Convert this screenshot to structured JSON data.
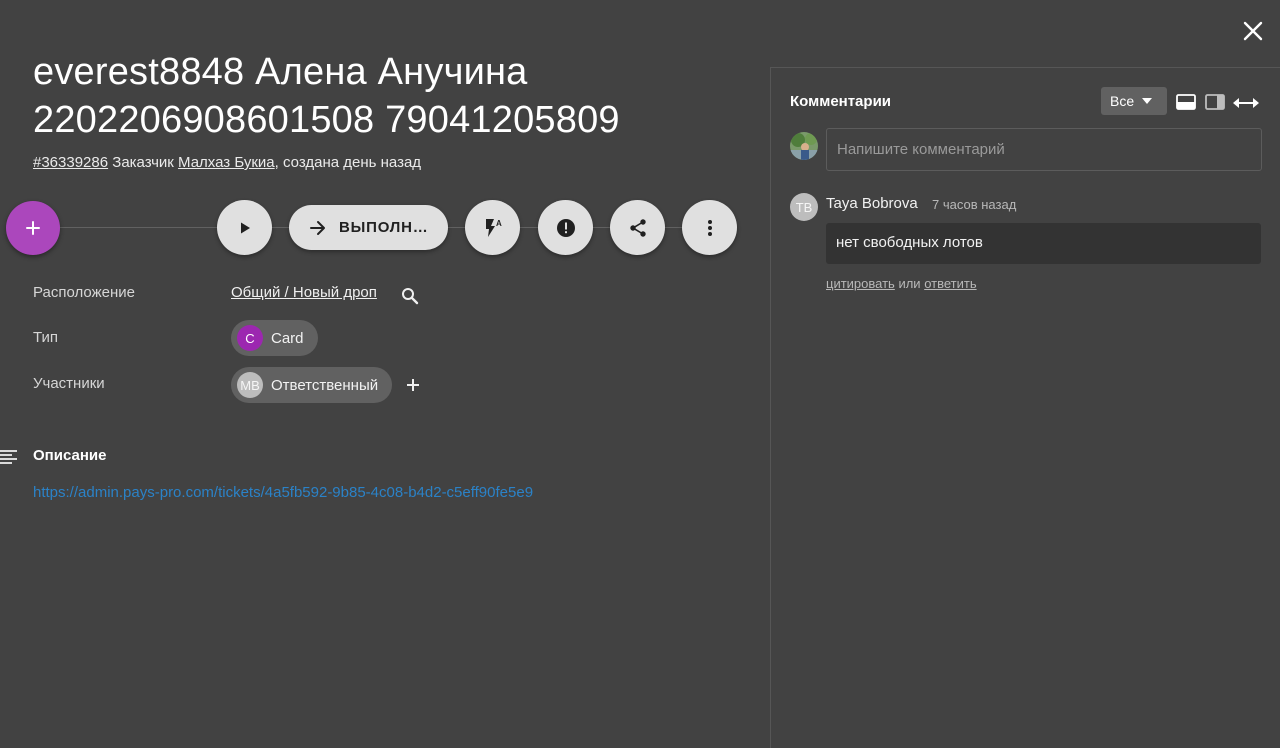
{
  "ticket": {
    "title_line1": "everest8848 Алена Анучина",
    "title_line2": "2202206908601508 79041205809",
    "number": "#36339286",
    "customer_prefix": "Заказчик",
    "customer_name": "Малхаз Букиа",
    "created_suffix": ", создана день назад"
  },
  "toolbar": {
    "status_button_label": "ВЫПОЛН…"
  },
  "fields": {
    "location": {
      "label": "Расположение",
      "value": "Общий / Новый дроп"
    },
    "type": {
      "label": "Тип",
      "avatar_letter": "C",
      "value": "Card",
      "avatar_color": "#9c27b0"
    },
    "participants": {
      "label": "Участники",
      "avatar_initials": "MB",
      "value": "Ответственный"
    }
  },
  "description": {
    "title": "Описание",
    "link": "https://admin.pays-pro.com/tickets/4a5fb592-9b85-4c08-b4d2-c5eff90fe5e9"
  },
  "comments_panel": {
    "title": "Комментарии",
    "filter_value": "Все",
    "input_placeholder": "Напишите комментарий",
    "comments": [
      {
        "initials": "TB",
        "author": "Taya Bobrova",
        "time": "7 часов назад",
        "text": "нет свободных лотов",
        "quote_label": "цитировать",
        "or_label": "или",
        "reply_label": "ответить"
      }
    ]
  },
  "colors": {
    "background": "#424242",
    "fab_accent": "#ab47bc",
    "link": "#2b82c7",
    "round_button": "#e0e0e0"
  },
  "icons": [
    "close-icon",
    "plus-icon",
    "play-icon",
    "arrow-right-icon",
    "flash-auto-icon",
    "alert-circle-icon",
    "share-icon",
    "more-vert-icon",
    "search-icon",
    "add-icon",
    "description-lines-icon",
    "caret-down-icon",
    "panel-bottom-icon",
    "panel-right-icon",
    "expand-horizontal-icon"
  ]
}
